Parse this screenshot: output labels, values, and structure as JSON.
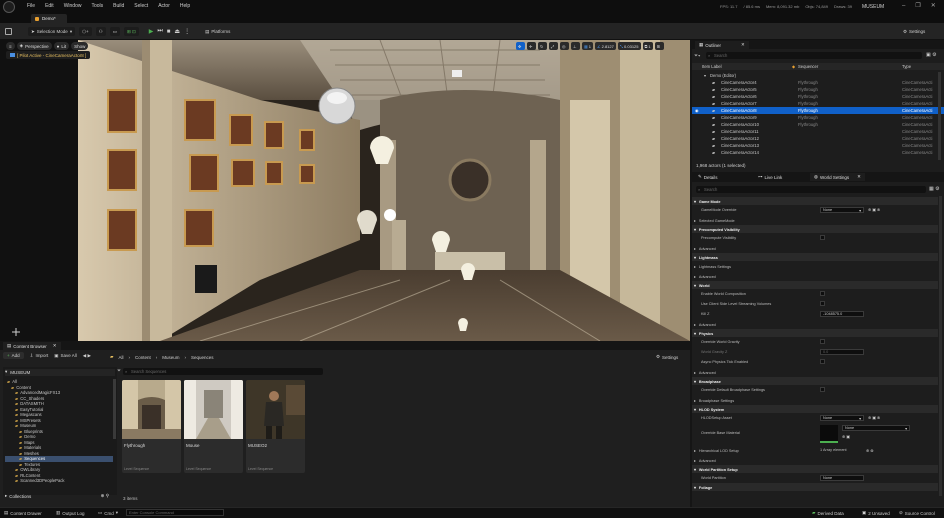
{
  "menubar": {
    "items": [
      "File",
      "Edit",
      "Window",
      "Tools",
      "Build",
      "Select",
      "Actor",
      "Help"
    ],
    "stats": [
      "FPS: 11.7",
      "/ 85.6 ms",
      "Mem: 8,091.32 mb",
      "Objs: 74,849",
      "Draws: 39"
    ],
    "project": "MUSEUM",
    "minimize": "–",
    "maximize": "❐",
    "close": "✕"
  },
  "level_tab": {
    "label": "Demo*"
  },
  "toolbar": {
    "selection_mode": "Selection Mode",
    "platforms": "Platforms",
    "settings": "Settings"
  },
  "viewport": {
    "perspective": "Perspective",
    "lit": "Lit",
    "show": "Show",
    "pilot_label": "[ Pilot Active - CineCameraActor8 ]",
    "grid_value": "1",
    "angle_value": "2.8127",
    "scale_value": "0.03125",
    "camera_speed": "1"
  },
  "content_browser": {
    "tab": "Content Browser",
    "add": "Add",
    "import": "Import",
    "save_all": "Save All",
    "breadcrumb": [
      "All",
      "Content",
      "Museum",
      "Sequences"
    ],
    "settings": "Settings",
    "source_header": "MUSEUM",
    "tree": [
      {
        "label": "All",
        "depth": 0
      },
      {
        "label": "Content",
        "depth": 1
      },
      {
        "label": "AdvancedMagicFX13",
        "depth": 2
      },
      {
        "label": "CC_Shaders",
        "depth": 2
      },
      {
        "label": "DATASMITH",
        "depth": 2
      },
      {
        "label": "EasyTutorial",
        "depth": 2
      },
      {
        "label": "Megascans",
        "depth": 2
      },
      {
        "label": "MSPresets",
        "depth": 2
      },
      {
        "label": "Museum",
        "depth": 2
      },
      {
        "label": "Blueprints",
        "depth": 3
      },
      {
        "label": "Demo",
        "depth": 3
      },
      {
        "label": "Maps",
        "depth": 3
      },
      {
        "label": "Materials",
        "depth": 3
      },
      {
        "label": "Meshes",
        "depth": 3
      },
      {
        "label": "Sequences",
        "depth": 3,
        "selected": true
      },
      {
        "label": "Textures",
        "depth": 3
      },
      {
        "label": "OWLibrary",
        "depth": 2
      },
      {
        "label": "RLContent",
        "depth": 2
      },
      {
        "label": "Scanned3DPeoplePack",
        "depth": 2
      }
    ],
    "collections": "Collections",
    "search_placeholder": "Search Sequences",
    "assets": [
      {
        "name": "Flythrough",
        "type": "Level Sequence"
      },
      {
        "name": "Mouse",
        "type": "Level Sequence"
      },
      {
        "name": "MUSEO2",
        "type": "Level Sequence"
      }
    ],
    "item_count": "3 items"
  },
  "statusbar": {
    "content_drawer": "Content Drawer",
    "output_log": "Output Log",
    "cmd": "Cmd",
    "cmd_placeholder": "Enter Console Command",
    "derived_data": "Derived Data",
    "unsaved": "2 Unsaved",
    "source_control": "Source Control"
  },
  "outliner": {
    "tab": "Outliner",
    "search_placeholder": "Search",
    "col_label": "Item Label",
    "col_sequencer": "Sequencer",
    "col_type": "Type",
    "root": "Demo (Editor)",
    "rows": [
      {
        "label": "CineCameraActor4",
        "seq": "Flythrough",
        "type": "CineCameraActi"
      },
      {
        "label": "CineCameraActor5",
        "seq": "Flythrough",
        "type": "CineCameraActi"
      },
      {
        "label": "CineCameraActor6",
        "seq": "Flythrough",
        "type": "CineCameraActi"
      },
      {
        "label": "CineCameraActor7",
        "seq": "Flythrough",
        "type": "CineCameraActi"
      },
      {
        "label": "CineCameraActor8",
        "seq": "Flythrough",
        "type": "CineCameraActi",
        "selected": true
      },
      {
        "label": "CineCameraActor9",
        "seq": "Flythrough",
        "type": "CineCameraActi"
      },
      {
        "label": "CineCameraActor10",
        "seq": "Flythrough",
        "type": "CineCameraActi"
      },
      {
        "label": "CineCameraActor11",
        "seq": "",
        "type": "CineCameraActi"
      },
      {
        "label": "CineCameraActor12",
        "seq": "",
        "type": "CineCameraActi"
      },
      {
        "label": "CineCameraActor13",
        "seq": "",
        "type": "CineCameraActi"
      },
      {
        "label": "CineCameraActor14",
        "seq": "",
        "type": "CineCameraActi"
      }
    ],
    "footer": "1,968 actors (1 selected)"
  },
  "details": {
    "tabs": [
      "Details",
      "Live Link",
      "World Settings"
    ],
    "search_placeholder": "Search",
    "rows": [
      {
        "kind": "cat",
        "label": "Game Mode"
      },
      {
        "kind": "prop",
        "label": "GameMode Override",
        "value": "None",
        "ctrl": "dropdown"
      },
      {
        "kind": "sub",
        "label": "Selected GameMode"
      },
      {
        "kind": "cat",
        "label": "Precomputed Visibility"
      },
      {
        "kind": "prop",
        "label": "Precompute Visibility",
        "ctrl": "check"
      },
      {
        "kind": "sub",
        "label": "Advanced"
      },
      {
        "kind": "cat",
        "label": "Lightmass"
      },
      {
        "kind": "sub",
        "label": "Lightmass Settings"
      },
      {
        "kind": "sub",
        "label": "Advanced"
      },
      {
        "kind": "cat",
        "label": "World"
      },
      {
        "kind": "prop",
        "label": "Enable World Composition",
        "ctrl": "check"
      },
      {
        "kind": "prop",
        "label": "Use Client Side Level Streaming Volumes",
        "ctrl": "check"
      },
      {
        "kind": "prop",
        "label": "Kill Z",
        "value": "-1048575.0",
        "ctrl": "number"
      },
      {
        "kind": "sub",
        "label": "Advanced"
      },
      {
        "kind": "cat",
        "label": "Physics"
      },
      {
        "kind": "prop",
        "label": "Override World Gravity",
        "ctrl": "check"
      },
      {
        "kind": "prop",
        "label": "World Gravity Z",
        "value": "0.0",
        "ctrl": "number",
        "dim": true
      },
      {
        "kind": "prop",
        "label": "Async Physics Tick Enabled",
        "ctrl": "check"
      },
      {
        "kind": "sub",
        "label": "Advanced"
      },
      {
        "kind": "cat",
        "label": "Broadphase"
      },
      {
        "kind": "prop",
        "label": "Override Default Broadphase Settings",
        "ctrl": "check"
      },
      {
        "kind": "sub",
        "label": "Broadphase Settings"
      },
      {
        "kind": "cat",
        "label": "HLOD System"
      },
      {
        "kind": "prop",
        "label": "HLODSetup Asset",
        "value": "None",
        "ctrl": "dropdown"
      },
      {
        "kind": "prop",
        "label": "Override Base Material",
        "value": "None",
        "ctrl": "material",
        "tall": true
      },
      {
        "kind": "sub",
        "label": "Hierarchical LOD Setup",
        "value": "1 Array element"
      },
      {
        "kind": "sub",
        "label": "Advanced"
      },
      {
        "kind": "cat",
        "label": "World Partition Setup"
      },
      {
        "kind": "prop",
        "label": "World Partition",
        "value": "None",
        "ctrl": "text"
      },
      {
        "kind": "cat",
        "label": "Foliage"
      }
    ]
  },
  "colors": {
    "accent": "#1060c8",
    "selected_row": "#3a4f6e",
    "play": "#4caf50",
    "category": "#2a2a2a"
  }
}
